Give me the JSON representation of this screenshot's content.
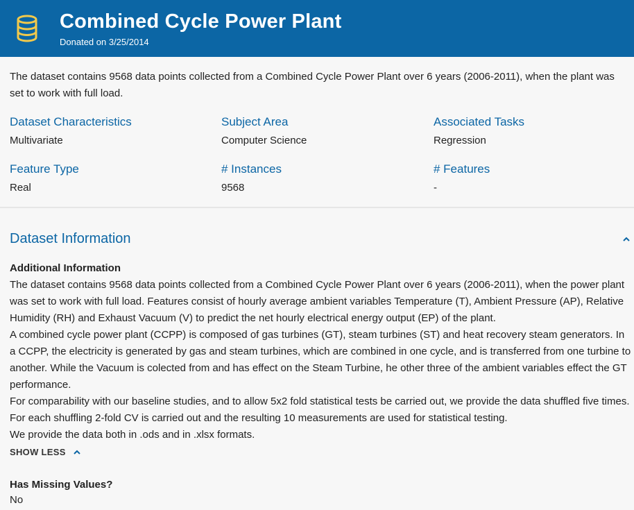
{
  "header": {
    "title": "Combined Cycle Power Plant",
    "donated": "Donated on 3/25/2014",
    "icon": "database-icon",
    "background_color": "#0c66a5",
    "icon_color": "#f2c94c"
  },
  "summary": "The dataset contains 9568 data points collected from a Combined Cycle Power Plant over 6 years (2006-2011), when the plant was set to work with full load.",
  "characteristics": [
    {
      "label": "Dataset Characteristics",
      "value": "Multivariate"
    },
    {
      "label": "Subject Area",
      "value": "Computer Science"
    },
    {
      "label": "Associated Tasks",
      "value": "Regression"
    },
    {
      "label": "Feature Type",
      "value": "Real"
    },
    {
      "label": "# Instances",
      "value": "9568"
    },
    {
      "label": "# Features",
      "value": "-"
    }
  ],
  "dataset_info": {
    "title": "Dataset Information",
    "collapse_icon": "chevron-up-icon",
    "additional_heading": "Additional Information",
    "paragraphs": [
      "The dataset contains 9568 data points collected from a Combined Cycle Power Plant over 6 years (2006-2011), when the power plant was set to work with full load. Features consist of hourly average ambient variables Temperature (T), Ambient Pressure (AP), Relative Humidity (RH) and Exhaust Vacuum (V) to predict the net hourly electrical energy output (EP)  of the plant.",
      "A combined cycle power plant (CCPP) is composed of gas turbines (GT), steam turbines (ST) and heat recovery steam generators. In a CCPP, the electricity is generated by gas and steam turbines, which are combined in one cycle, and is transferred from one turbine to another. While the Vacuum is colected from and has effect on the Steam Turbine, he other three of the ambient variables effect the GT performance.",
      "For comparability with our baseline studies, and to allow 5x2 fold statistical tests be carried out, we provide the data shuffled five times. For each shuffling 2-fold CV is carried out and the resulting 10 measurements are used for statistical testing.",
      "We provide the data both in .ods and in .xlsx formats."
    ],
    "show_less_label": "SHOW LESS",
    "missing_values_heading": "Has Missing Values?",
    "missing_values_value": "No"
  }
}
